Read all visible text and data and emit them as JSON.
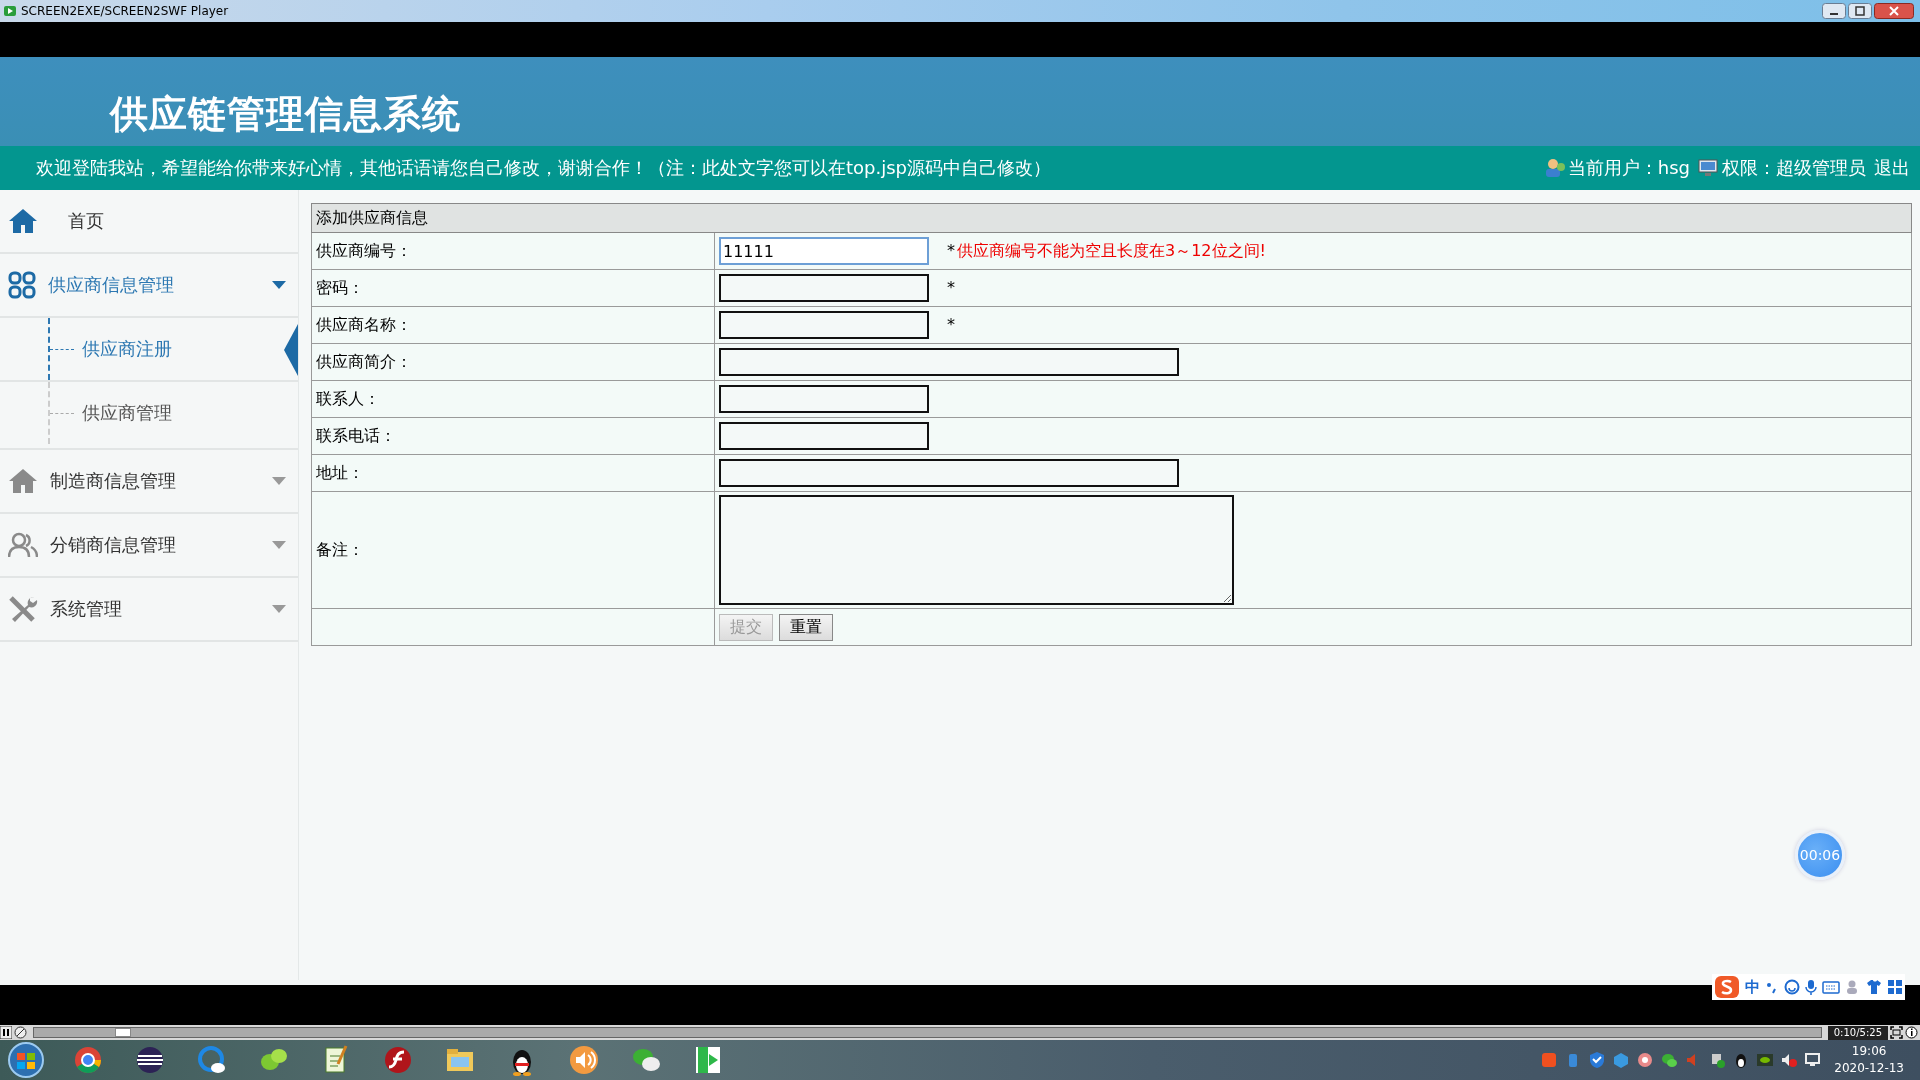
{
  "window": {
    "title": "SCREEN2EXE/SCREEN2SWF Player"
  },
  "header": {
    "title": "供应链管理信息系统",
    "welcome": "欢迎登陆我站，希望能给你带来好心情，其他话语请您自己修改，谢谢合作！（注：此处文字您可以在top.jsp源码中自己修改）",
    "current_user": "当前用户：hsg",
    "permission": "权限：超级管理员",
    "logout": "退出"
  },
  "sidebar": [
    {
      "label": "首页",
      "kind": "link"
    },
    {
      "label": "供应商信息管理",
      "kind": "group",
      "expanded": true,
      "children": [
        {
          "label": "供应商注册",
          "selected": true
        },
        {
          "label": "供应商管理",
          "selected": false
        }
      ]
    },
    {
      "label": "制造商信息管理",
      "kind": "group",
      "expanded": false
    },
    {
      "label": "分销商信息管理",
      "kind": "group",
      "expanded": false
    },
    {
      "label": "系统管理",
      "kind": "group",
      "expanded": false
    }
  ],
  "form": {
    "title": "添加供应商信息",
    "fields": [
      {
        "label": "供应商编号：",
        "kind": "short",
        "value": "11111",
        "focused": true,
        "required_mark": "*",
        "error": "供应商编号不能为空且长度在3～12位之间!"
      },
      {
        "label": "密码：",
        "kind": "short",
        "focused": false,
        "required_mark": "*"
      },
      {
        "label": "供应商名称：",
        "kind": "short",
        "focused": false,
        "required_mark": "*"
      },
      {
        "label": "供应商简介：",
        "kind": "long",
        "focused": false
      },
      {
        "label": "联系人：",
        "kind": "short",
        "focused": false
      },
      {
        "label": "联系电话：",
        "kind": "short",
        "focused": false
      },
      {
        "label": "地址：",
        "kind": "long",
        "focused": false
      },
      {
        "label": "备注：",
        "kind": "textarea",
        "focused": false
      }
    ],
    "buttons": [
      {
        "label": "提交",
        "disabled": true
      },
      {
        "label": "重置",
        "disabled": false
      }
    ]
  },
  "timer_badge": "00:06",
  "ime_toolbar": {
    "mode": "中"
  },
  "player": {
    "time": "0:10/5:25",
    "level": 0.05
  },
  "taskbar": {
    "time": "19:06",
    "date": "2020-12-13"
  }
}
